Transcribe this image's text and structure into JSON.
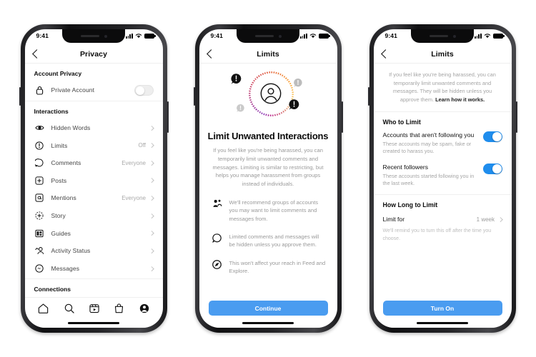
{
  "statusbar": {
    "time": "9:41",
    "signal_icon": "cellular-signal-icon",
    "wifi_icon": "wifi-icon",
    "battery_icon": "battery-icon"
  },
  "colors": {
    "accent_blue": "#4a9cf0",
    "toggle_on": "#1f8ded",
    "text_primary": "#0a0a0a",
    "text_secondary": "#9a9a9a",
    "divider": "#efefef"
  },
  "phone1": {
    "nav": {
      "back_icon": "chevron-left-icon",
      "title": "Privacy"
    },
    "sections": [
      {
        "header": "Account Privacy",
        "rows": [
          {
            "icon": "lock-icon",
            "label": "Private Account",
            "value": "",
            "control": "toggle-off"
          }
        ]
      },
      {
        "header": "Interactions",
        "rows": [
          {
            "icon": "hidden-words-icon",
            "label": "Hidden Words",
            "value": "",
            "control": "chevron"
          },
          {
            "icon": "limits-icon",
            "label": "Limits",
            "value": "Off",
            "control": "chevron"
          },
          {
            "icon": "comment-icon",
            "label": "Comments",
            "value": "Everyone",
            "control": "chevron"
          },
          {
            "icon": "posts-icon",
            "label": "Posts",
            "value": "",
            "control": "chevron"
          },
          {
            "icon": "mentions-icon",
            "label": "Mentions",
            "value": "Everyone",
            "control": "chevron"
          },
          {
            "icon": "story-icon",
            "label": "Story",
            "value": "",
            "control": "chevron"
          },
          {
            "icon": "guides-icon",
            "label": "Guides",
            "value": "",
            "control": "chevron"
          },
          {
            "icon": "activity-status-icon",
            "label": "Activity Status",
            "value": "",
            "control": "chevron"
          },
          {
            "icon": "messenger-icon",
            "label": "Messages",
            "value": "",
            "control": "chevron"
          }
        ]
      },
      {
        "header": "Connections",
        "rows": []
      }
    ],
    "tabbar": [
      {
        "icon": "home-icon",
        "name": "tab-home"
      },
      {
        "icon": "search-icon",
        "name": "tab-search"
      },
      {
        "icon": "reels-icon",
        "name": "tab-reels"
      },
      {
        "icon": "shop-icon",
        "name": "tab-shop"
      },
      {
        "icon": "profile-icon",
        "name": "tab-profile"
      }
    ]
  },
  "phone2": {
    "nav": {
      "back_icon": "chevron-left-icon",
      "title": "Limits"
    },
    "illustration": {
      "name": "limit-unwanted-interactions-illustration",
      "center_icon": "user-avatar-icon",
      "bubbles": [
        "alert-bubble-icon",
        "alert-bubble-icon",
        "alert-bubble-icon",
        "alert-bubble-icon"
      ]
    },
    "title": "Limit Unwanted Interactions",
    "subtitle": "If you feel like you're being harassed, you can temporarily limit unwanted comments and messages. Limiting is similar to restricting, but helps you manage harassment from groups instead of individuals.",
    "bullets": [
      {
        "icon": "people-group-icon",
        "text": "We'll recommend groups of accounts you may want to limit comments and messages from."
      },
      {
        "icon": "comment-icon",
        "text": "Limited comments and messages will be hidden unless you approve them."
      },
      {
        "icon": "compass-icon",
        "text": "This won't affect your reach in Feed and Explore."
      }
    ],
    "cta_label": "Continue"
  },
  "phone3": {
    "nav": {
      "back_icon": "chevron-left-icon",
      "title": "Limits"
    },
    "intro_text": "If you feel like you're being harassed, you can temporarily limit unwanted comments and messages. They will be hidden unless you approve them. ",
    "intro_link": "Learn how it works.",
    "who_header": "Who to Limit",
    "options": [
      {
        "title": "Accounts that aren't following you",
        "desc": "These accounts may be spam, fake or created to harass you.",
        "toggle": "on"
      },
      {
        "title": "Recent followers",
        "desc": "These accounts started following you in the last week.",
        "toggle": "on"
      }
    ],
    "how_long_header": "How Long to Limit",
    "limit_for_label": "Limit for",
    "limit_for_value": "1 week",
    "note": "We'll remind you to turn this off after the time you choose.",
    "cta_label": "Turn On"
  }
}
